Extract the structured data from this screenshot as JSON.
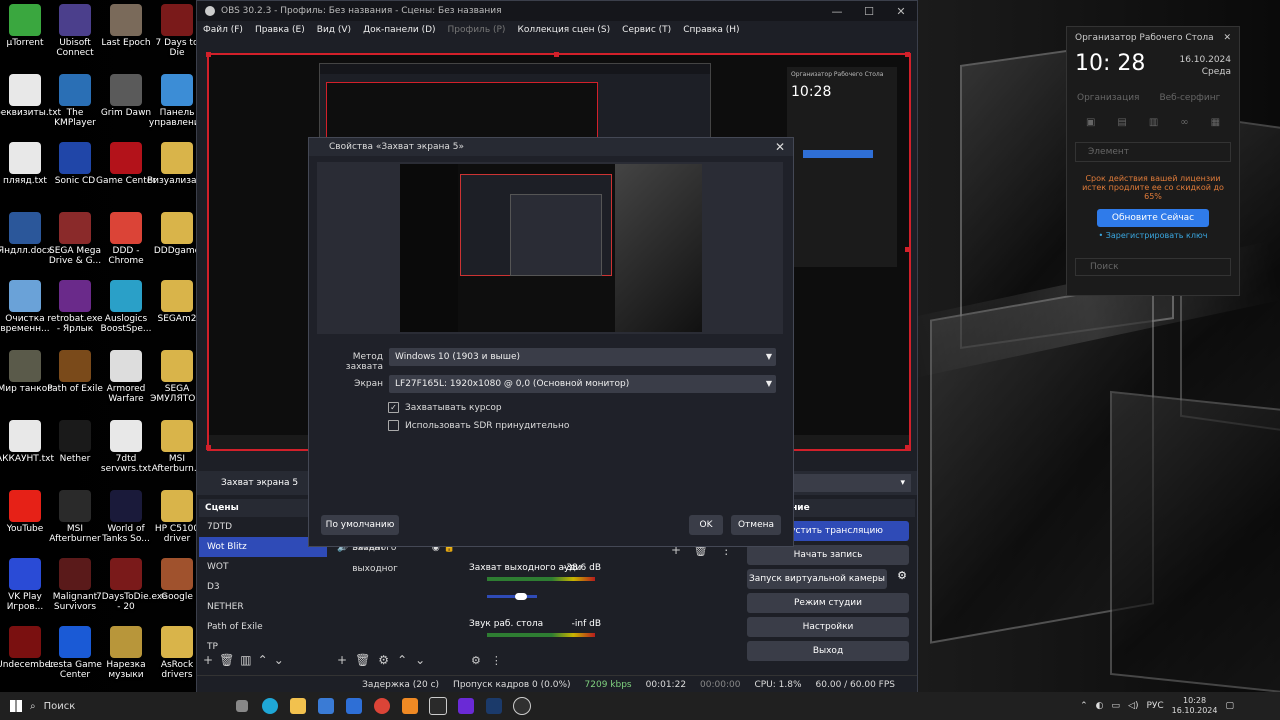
{
  "desktop": {
    "icons": [
      {
        "label": "µTorrent",
        "color": "#3aa73f"
      },
      {
        "label": "Ubisoft Connect",
        "color": "#4b3f8c"
      },
      {
        "label": "Last Epoch",
        "color": "#7a6a5a"
      },
      {
        "label": "7 Days to Die",
        "color": "#7a1a1a"
      },
      {
        "label": "реквизиты.txt",
        "color": "#e8e8e8"
      },
      {
        "label": "The KMPlayer",
        "color": "#2a6fb5"
      },
      {
        "label": "Grim Dawn",
        "color": "#5a5a5a"
      },
      {
        "label": "Панель управления",
        "color": "#3c8dd6"
      },
      {
        "label": "пляяд.txt",
        "color": "#e8e8e8"
      },
      {
        "label": "Sonic CD",
        "color": "#2046a8"
      },
      {
        "label": "Game Center",
        "color": "#b3121a"
      },
      {
        "label": "Визуализатор",
        "color": "#d9b44a"
      },
      {
        "label": "Яндлл.docx",
        "color": "#2b579a"
      },
      {
        "label": "SEGA Mega Drive & G...",
        "color": "#8a2a2a"
      },
      {
        "label": "DDD - Chrome",
        "color": "#db4437"
      },
      {
        "label": "DDDgame",
        "color": "#d9b44a"
      },
      {
        "label": "Очистка временн...",
        "color": "#6aa2d8"
      },
      {
        "label": "retrobat.exe - Ярлык",
        "color": "#6a2a8a"
      },
      {
        "label": "Auslogics BoostSpe...",
        "color": "#2aa0c8"
      },
      {
        "label": "SEGAm2",
        "color": "#d9b44a"
      },
      {
        "label": "Мир танков",
        "color": "#5a5a4a"
      },
      {
        "label": "Path of Exile",
        "color": "#7a4a1a"
      },
      {
        "label": "Armored Warfare",
        "color": "#dddddd"
      },
      {
        "label": "SEGA ЭМУЛЯТО...",
        "color": "#d9b44a"
      },
      {
        "label": "АККАУНТ.txt",
        "color": "#e8e8e8"
      },
      {
        "label": "Nether",
        "color": "#1a1a1a"
      },
      {
        "label": "7dtd servwrs.txt",
        "color": "#e8e8e8"
      },
      {
        "label": "MSI Afterburn...",
        "color": "#d9b44a"
      },
      {
        "label": "YouTube",
        "color": "#e62117"
      },
      {
        "label": "MSI Afterburner",
        "color": "#2a2a2a"
      },
      {
        "label": "World of Tanks So...",
        "color": "#1a1a3a"
      },
      {
        "label": "HP C5100 driver",
        "color": "#d9b44a"
      },
      {
        "label": "VK Play Игров...",
        "color": "#2a4bd6"
      },
      {
        "label": "Malignant Survivors",
        "color": "#5a1a1a"
      },
      {
        "label": "7DaysToDie.exe - 20",
        "color": "#7a1a1a"
      },
      {
        "label": "Google",
        "color": "#a0522d"
      },
      {
        "label": "Undecember",
        "color": "#7a1010"
      },
      {
        "label": "Lesta Game Center",
        "color": "#1a5ad6"
      },
      {
        "label": "Нарезка музыки",
        "color": "#b8963a"
      },
      {
        "label": "AsRock drivers",
        "color": "#d9b44a"
      }
    ]
  },
  "obs": {
    "title": "OBS 30.2.3 - Профиль: Без названия - Сцены: Без названия",
    "menu": [
      {
        "label": "Файл (F)",
        "enabled": true
      },
      {
        "label": "Правка (E)",
        "enabled": true
      },
      {
        "label": "Вид (V)",
        "enabled": true
      },
      {
        "label": "Док-панели (D)",
        "enabled": true
      },
      {
        "label": "Профиль (P)",
        "enabled": false
      },
      {
        "label": "Коллекция сцен (S)",
        "enabled": true
      },
      {
        "label": "Сервис (T)",
        "enabled": true
      },
      {
        "label": "Справка (H)",
        "enabled": true
      }
    ],
    "source_selected": "Захват экрана 5",
    "scenes": {
      "header": "Сцены",
      "items": [
        "7DTD",
        "Wot Blitz",
        "WOT",
        "D3",
        "NETHER",
        "Path of Exile",
        "TP"
      ],
      "selected_index": 1
    },
    "sources": {
      "items": [
        "Захват входного",
        "Захват выходног"
      ]
    },
    "mixer": {
      "channels": [
        {
          "name": "",
          "db": ""
        },
        {
          "name": "Захват выходного ауди",
          "db": "-38.6 dB"
        },
        {
          "name": "Звук раб. стола",
          "db": "-inf dB"
        }
      ],
      "scale": "-60-55-50-45-40-35-30-25-20-15-10 -5 0"
    },
    "controls": {
      "header": "Управление",
      "stream": "Запустить трансляцию",
      "record": "Начать запись",
      "virtual_cam": "Запуск виртуальной камеры",
      "studio": "Режим студии",
      "settings": "Настройки",
      "exit": "Выход"
    },
    "status": {
      "delay": "Задержка (20 с)",
      "dropped": "Пропуск кадров 0 (0.0%)",
      "bitrate": "7209 kbps",
      "time1": "00:01:22",
      "time2": "00:00:00",
      "cpu": "CPU: 1.8%",
      "fps": "60.00 / 60.00 FPS"
    }
  },
  "dialog": {
    "title": "Свойства «Захват экрана 5»",
    "method_label": "Метод захвата",
    "method_value": "Windows 10 (1903 и выше)",
    "screen_label": "Экран",
    "screen_value": "LF27F165L: 1920x1080 @ 0,0 (Основной монитор)",
    "capture_cursor": "Захватывать курсор",
    "capture_cursor_checked": true,
    "force_sdr": "Использовать SDR принудительно",
    "force_sdr_checked": false,
    "defaults_button": "По умолчанию",
    "ok_button": "OK",
    "cancel_button": "Отмена"
  },
  "organizer": {
    "title": "Организатор Рабочего Стола",
    "time": "10: 28",
    "date": "16.10.2024",
    "weekday": "Среда",
    "tab_organize": "Организация",
    "tab_web": "Веб-серфинг",
    "element": "Элемент",
    "license_text": "Срок действия вашей лицензии истек продлите ее со скидкой до 65%",
    "update_button": "Обновите Сейчас",
    "register_link": "• Зарегистрировать ключ",
    "search": "Поиск"
  },
  "taskbar": {
    "search_placeholder": "Поиск",
    "lang": "РУС",
    "time": "10:28",
    "date": "16.10.2024"
  }
}
